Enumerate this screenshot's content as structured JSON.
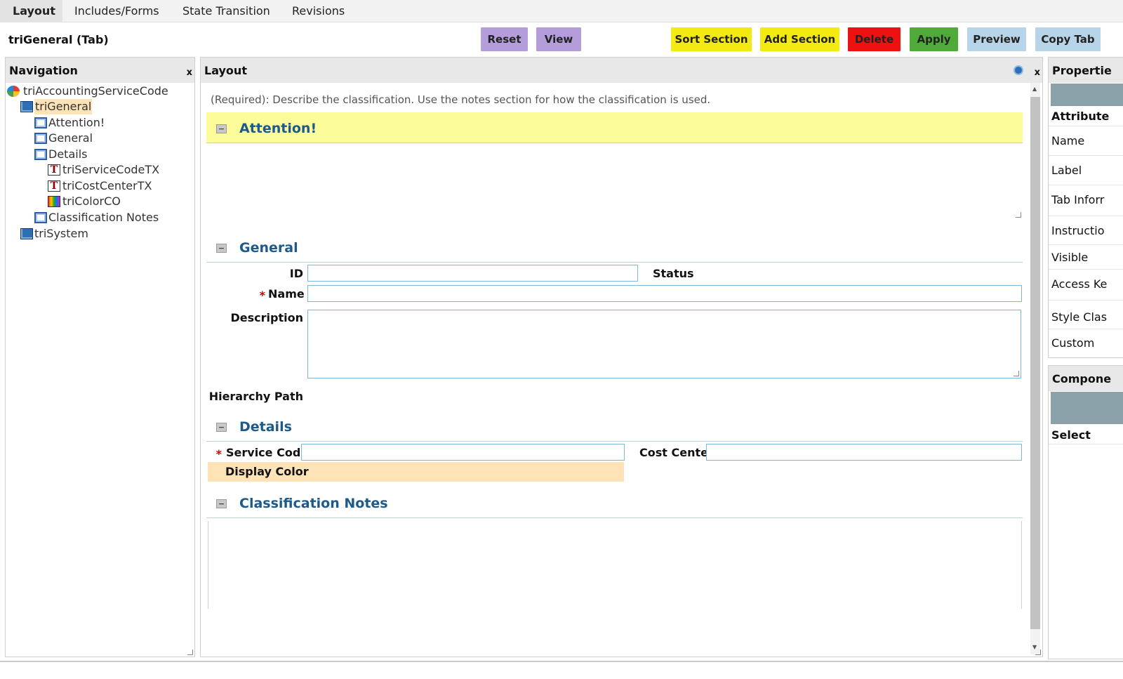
{
  "top_tabs": {
    "layout": "Layout",
    "includes": "Includes/Forms",
    "state": "State Transition",
    "revisions": "Revisions"
  },
  "toolbar": {
    "title": "triGeneral (Tab)",
    "reset": "Reset",
    "view": "View",
    "sort_section": "Sort Section",
    "add_section": "Add Section",
    "delete": "Delete",
    "apply": "Apply",
    "preview": "Preview",
    "copy_tab": "Copy Tab"
  },
  "navigation": {
    "title": "Navigation",
    "close": "x",
    "tree": {
      "root": "triAccountingServiceCode",
      "tab_general": "triGeneral",
      "attention": "Attention!",
      "general": "General",
      "details": "Details",
      "service_code": "triServiceCodeTX",
      "cost_center": "triCostCenterTX",
      "color": "triColorCO",
      "notes": "Classification Notes",
      "tab_system": "triSystem"
    }
  },
  "layout": {
    "title": "Layout",
    "close": "x",
    "instructions": "(Required): Describe the classification. Use the notes section for how the classification is used.",
    "sections": {
      "attention": "Attention!",
      "general": "General",
      "details": "Details",
      "notes": "Classification Notes"
    },
    "collapse_symbol": "−",
    "fields": {
      "id": "ID",
      "status": "Status",
      "name": "Name",
      "description": "Description",
      "hierarchy_path": "Hierarchy Path",
      "service_code": "Service Code",
      "cost_center": "Cost Center",
      "display_color": "Display Color",
      "required_mark": "*"
    }
  },
  "properties": {
    "title": "Propertie",
    "attribute_header": "Attribute",
    "rows": {
      "name": "Name",
      "label": "Label",
      "tab_info": "Tab Inforr",
      "instruction": "Instructio",
      "visible": "Visible",
      "access_key": "Access Ke",
      "style_class": "Style Clas",
      "custom": "Custom"
    },
    "components_title": "Compone",
    "select": "Select"
  }
}
